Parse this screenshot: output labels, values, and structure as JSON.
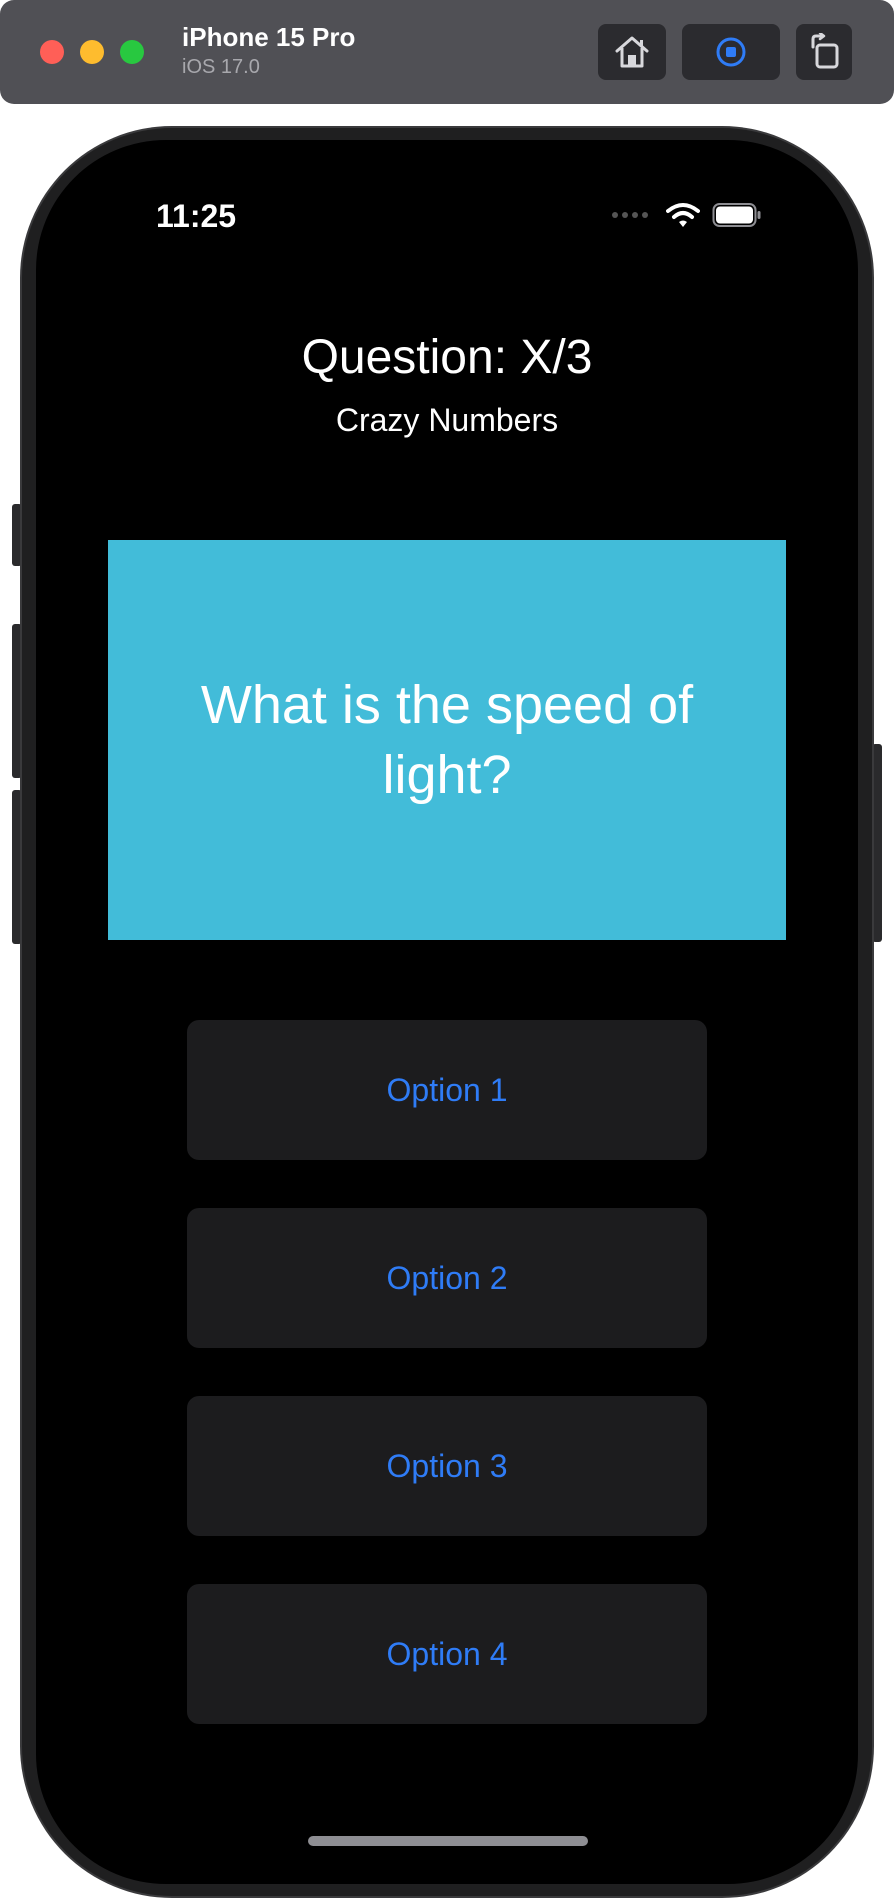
{
  "simulator": {
    "device_name": "iPhone 15 Pro",
    "os_version": "iOS 17.0",
    "toolbar_icons": [
      "home-icon",
      "screenshot-icon",
      "rotate-icon"
    ]
  },
  "status_bar": {
    "time": "11:25",
    "icons": [
      "signal-icon",
      "wifi-icon",
      "battery-icon"
    ]
  },
  "quiz": {
    "title": "Question: X/3",
    "category": "Crazy Numbers",
    "question": "What is the speed of light?",
    "options": [
      "Option 1",
      "Option 2",
      "Option 3",
      "Option 4"
    ]
  },
  "colors": {
    "question_card": "#42bcd9",
    "option_text": "#2f7cf6",
    "option_background": "#1c1c1e",
    "screen_background": "#000000"
  }
}
